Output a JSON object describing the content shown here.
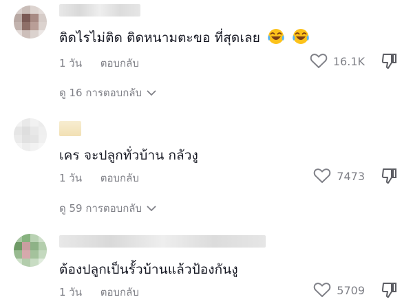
{
  "comments": [
    {
      "text": "ติดไรไม่ติด ติดหนามตะขอ ที่สุดเลย",
      "emojis": [
        "laughing-tears-emoji",
        "laughing-tears-emoji"
      ],
      "time": "1 วัน",
      "reply_label": "ตอบกลับ",
      "likes": "16.1K",
      "view_replies": "ดู 16 การตอบกลับ"
    },
    {
      "text": "เคร จะปลูกทั่วบ้าน กลัวงู",
      "time": "1 วัน",
      "reply_label": "ตอบกลับ",
      "likes": "7473",
      "view_replies": "ดู 59 การตอบกลับ"
    },
    {
      "text": "ต้องปลูกเป็นรั้วบ้านแล้วป้องกันงู",
      "time": "1 วัน",
      "reply_label": "ตอบกลับ",
      "likes": "5709"
    }
  ],
  "icons": {
    "like": "heart-outline-icon",
    "dislike": "thumbs-down-icon",
    "expand": "chevron-down-icon"
  },
  "colors": {
    "text": "#161823",
    "muted": "#7f8087",
    "background": "#ffffff"
  }
}
